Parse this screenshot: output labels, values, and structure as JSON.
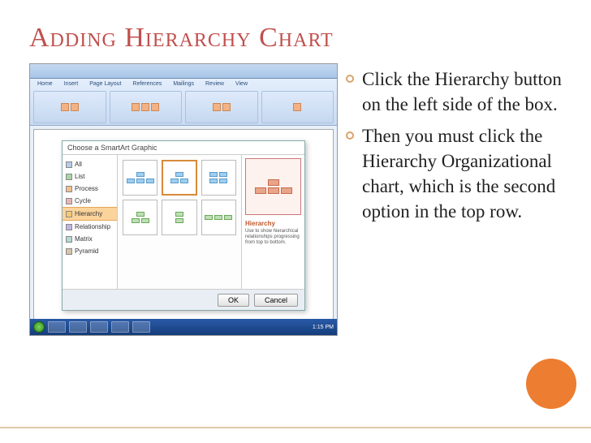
{
  "title": "Adding Hierarchy Chart",
  "bullets": [
    "Click the Hierarchy button on the left side of the box.",
    "Then you must click the Hierarchy Organizational chart, which is the second option in the top row."
  ],
  "screenshot": {
    "tabs": [
      "Home",
      "Insert",
      "Page Layout",
      "References",
      "Mailings",
      "Review",
      "View"
    ],
    "dialog": {
      "title": "Choose a SmartArt Graphic",
      "categories": [
        {
          "label": "All",
          "color": "#b5cde8"
        },
        {
          "label": "List",
          "color": "#a8d5a8"
        },
        {
          "label": "Process",
          "color": "#f0c090"
        },
        {
          "label": "Cycle",
          "color": "#e8b5b5"
        },
        {
          "label": "Hierarchy",
          "color": "#f5c978",
          "selected": true
        },
        {
          "label": "Relationship",
          "color": "#c0b5e0"
        },
        {
          "label": "Matrix",
          "color": "#b5d8d5"
        },
        {
          "label": "Pyramid",
          "color": "#d5c5a8"
        }
      ],
      "preview_label": "Hierarchy",
      "preview_desc": "Use to show hierarchical relationships progressing from top to bottom.",
      "buttons": {
        "ok": "OK",
        "cancel": "Cancel"
      }
    },
    "taskbar_time": "1:15 PM"
  }
}
